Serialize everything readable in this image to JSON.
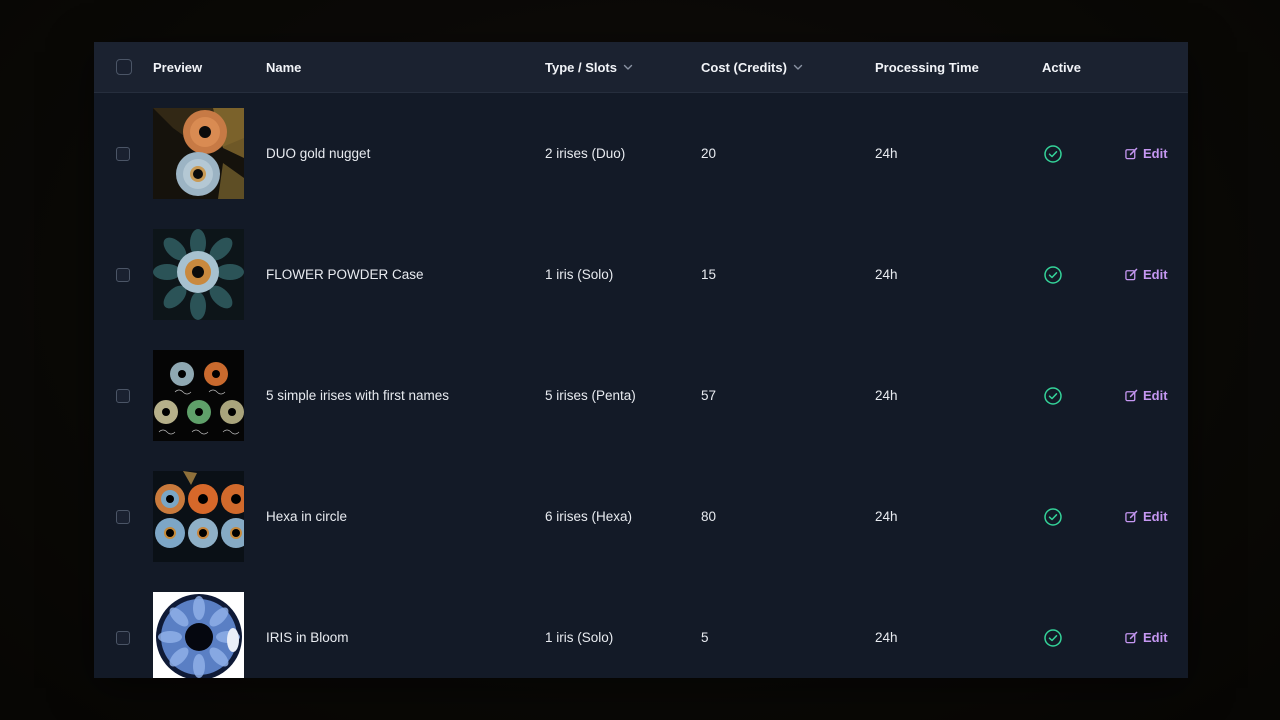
{
  "table": {
    "columns": {
      "preview": "Preview",
      "name": "Name",
      "type_slots": "Type / Slots",
      "cost": "Cost (Credits)",
      "processing_time": "Processing Time",
      "active": "Active"
    },
    "rows": [
      {
        "name": "DUO gold nugget",
        "type": "2 irises (Duo)",
        "cost": "20",
        "time": "24h",
        "active": true,
        "action": "Edit",
        "preview": "duo-gold-nugget-image"
      },
      {
        "name": "FLOWER POWDER Case",
        "type": "1 iris (Solo)",
        "cost": "15",
        "time": "24h",
        "active": true,
        "action": "Edit",
        "preview": "flower-powder-image"
      },
      {
        "name": "5 simple irises with first names",
        "type": "5 irises (Penta)",
        "cost": "57",
        "time": "24h",
        "active": true,
        "action": "Edit",
        "preview": "penta-irises-image"
      },
      {
        "name": "Hexa in circle",
        "type": "6 irises (Hexa)",
        "cost": "80",
        "time": "24h",
        "active": true,
        "action": "Edit",
        "preview": "hexa-circle-image"
      },
      {
        "name": "IRIS in Bloom",
        "type": "1 iris (Solo)",
        "cost": "5",
        "time": "24h",
        "active": true,
        "action": "Edit",
        "preview": "iris-bloom-image"
      }
    ]
  },
  "colors": {
    "table_bg": "#131a27",
    "header_bg": "#1b2230",
    "active_check": "#34d399",
    "edit_accent": "#c597f2"
  },
  "icons": {
    "sort": "chevron-down-icon",
    "active": "check-circle-icon",
    "edit": "edit-icon"
  }
}
